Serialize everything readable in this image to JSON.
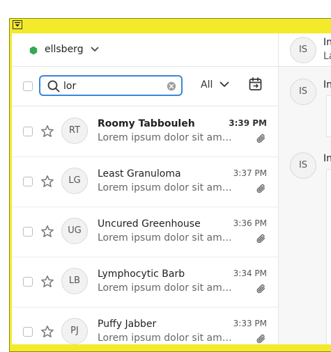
{
  "account": {
    "name": "ellsberg",
    "status_color": "#34a853"
  },
  "search": {
    "value": "lor",
    "placeholder": "Search"
  },
  "filter": {
    "label": "All"
  },
  "messages": [
    {
      "initials": "RT",
      "sender": "Roomy Tabbouleh",
      "time": "3:39 PM",
      "snippet": "Lorem ipsum dolor sit amet, consectetur",
      "unread": true
    },
    {
      "initials": "LG",
      "sender": "Least Granuloma",
      "time": "3:37 PM",
      "snippet": "Lorem ipsum dolor sit amet, consectetur",
      "unread": false
    },
    {
      "initials": "UG",
      "sender": "Uncured Greenhouse",
      "time": "3:36 PM",
      "snippet": "Lorem ipsum dolor sit amet, consectetur",
      "unread": false
    },
    {
      "initials": "LB",
      "sender": "Lymphocytic Barb",
      "time": "3:34 PM",
      "snippet": "Lorem ipsum dolor sit amet, consectetur",
      "unread": false
    },
    {
      "initials": "PJ",
      "sender": "Puffy Jabber",
      "time": "3:33 PM",
      "snippet": "Lorem ipsum dolor sit amet, consectetur",
      "unread": false
    }
  ],
  "reading_pane": {
    "header": {
      "initials": "IS",
      "title": "In",
      "subtitle": "La"
    },
    "items": [
      {
        "initials": "IS",
        "title": "In"
      },
      {
        "initials": "IS",
        "title": "In"
      }
    ]
  },
  "colors": {
    "accent": "#3a86d8",
    "frame": "#f4ea2c"
  },
  "icons": {
    "frame_button": "dropdown-icon",
    "search": "search-icon",
    "clear": "clear-icon",
    "calendar": "calendar-icon",
    "star": "star-icon",
    "attachment": "paperclip-icon"
  }
}
